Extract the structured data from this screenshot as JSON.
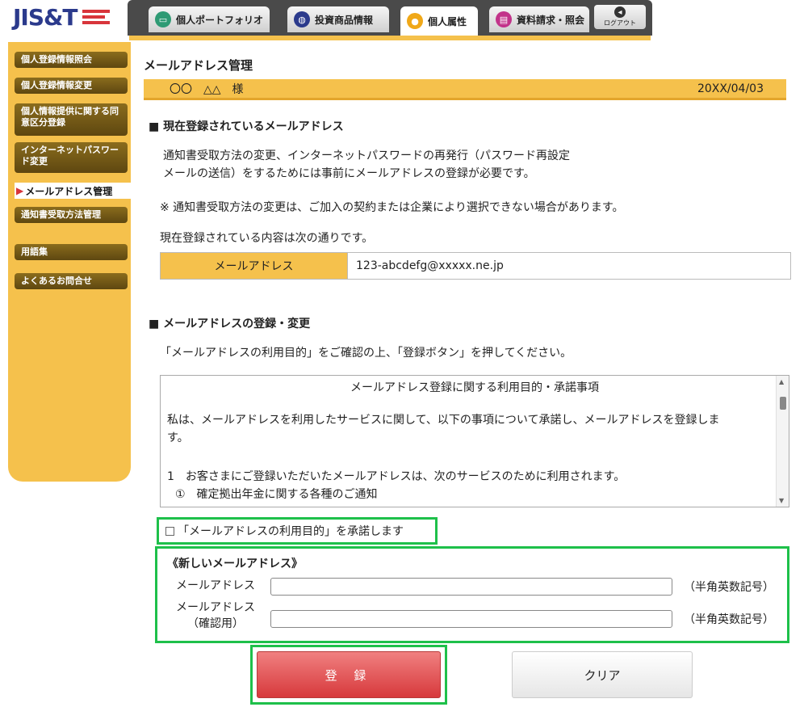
{
  "header": {
    "logo": "JIS&T",
    "tabs": [
      {
        "label": "個人ポートフォリオ",
        "icon": "portfolio-icon"
      },
      {
        "label": "投資商品情報",
        "icon": "globe-icon"
      },
      {
        "label": "個人属性",
        "icon": "person-icon"
      },
      {
        "label": "資料請求・照会",
        "icon": "document-icon"
      }
    ],
    "logout_label": "ログアウト",
    "accent": "#f5c14c"
  },
  "sidebar": {
    "items": [
      {
        "label": "個人登録情報照会"
      },
      {
        "label": "個人登録情報変更"
      },
      {
        "label": "個人情報提供に関する同意区分登録"
      },
      {
        "label": "インターネットパスワード変更"
      },
      {
        "label": "メールアドレス管理"
      },
      {
        "label": "通知書受取方法管理"
      },
      {
        "label": "用語集"
      },
      {
        "label": "よくあるお問合せ"
      }
    ]
  },
  "main": {
    "title": "メールアドレス管理",
    "user_name": "〇〇　△△　様",
    "date": "20XX/04/03",
    "current_section": {
      "heading": "■ 現在登録されているメールアドレス",
      "para1_line1": "通知書受取方法の変更、インターネットパスワードの再発行（パスワード再設定",
      "para1_line2": "メールの送信）をするためには事前にメールアドレスの登録が必要です。",
      "note": "※ 通知書受取方法の変更は、ご加入の契約または企業により選択できない場合があります。",
      "intro": "現在登録されている内容は次の通りです。",
      "table_header": "メールアドレス",
      "table_value": "123-abcdefg@xxxxx.ne.jp"
    },
    "register_section": {
      "heading": "■ メールアドレスの登録・変更",
      "instruction": "「メールアドレスの利用目的」をご確認の上、「登録ボタン」を押してください。",
      "terms_title": "メールアドレス登録に関する利用目的・承諾事項",
      "terms_line1": "私は、メールアドレスを利用したサービスに関して、以下の事項について承諾し、メールアドレスを登録しま",
      "terms_line2": "す。",
      "terms_line3": "1　お客さまにご登録いただいたメールアドレスは、次のサービスのために利用されます。",
      "terms_line4": "①　確定拠出年金に関する各種のご通知",
      "agree_label": "「メールアドレスの利用目的」を承諾します",
      "new_title": "《新しいメールアドレス》",
      "email_label": "メールアドレス",
      "confirm_label_line1": "メールアドレス",
      "confirm_label_line2": "（確認用）",
      "hint": "（半角英数記号）",
      "hint_confirm": "（半角英数記号）",
      "email_value": "",
      "confirm_value": ""
    },
    "register_button": "登 録",
    "clear_button": "クリア"
  }
}
